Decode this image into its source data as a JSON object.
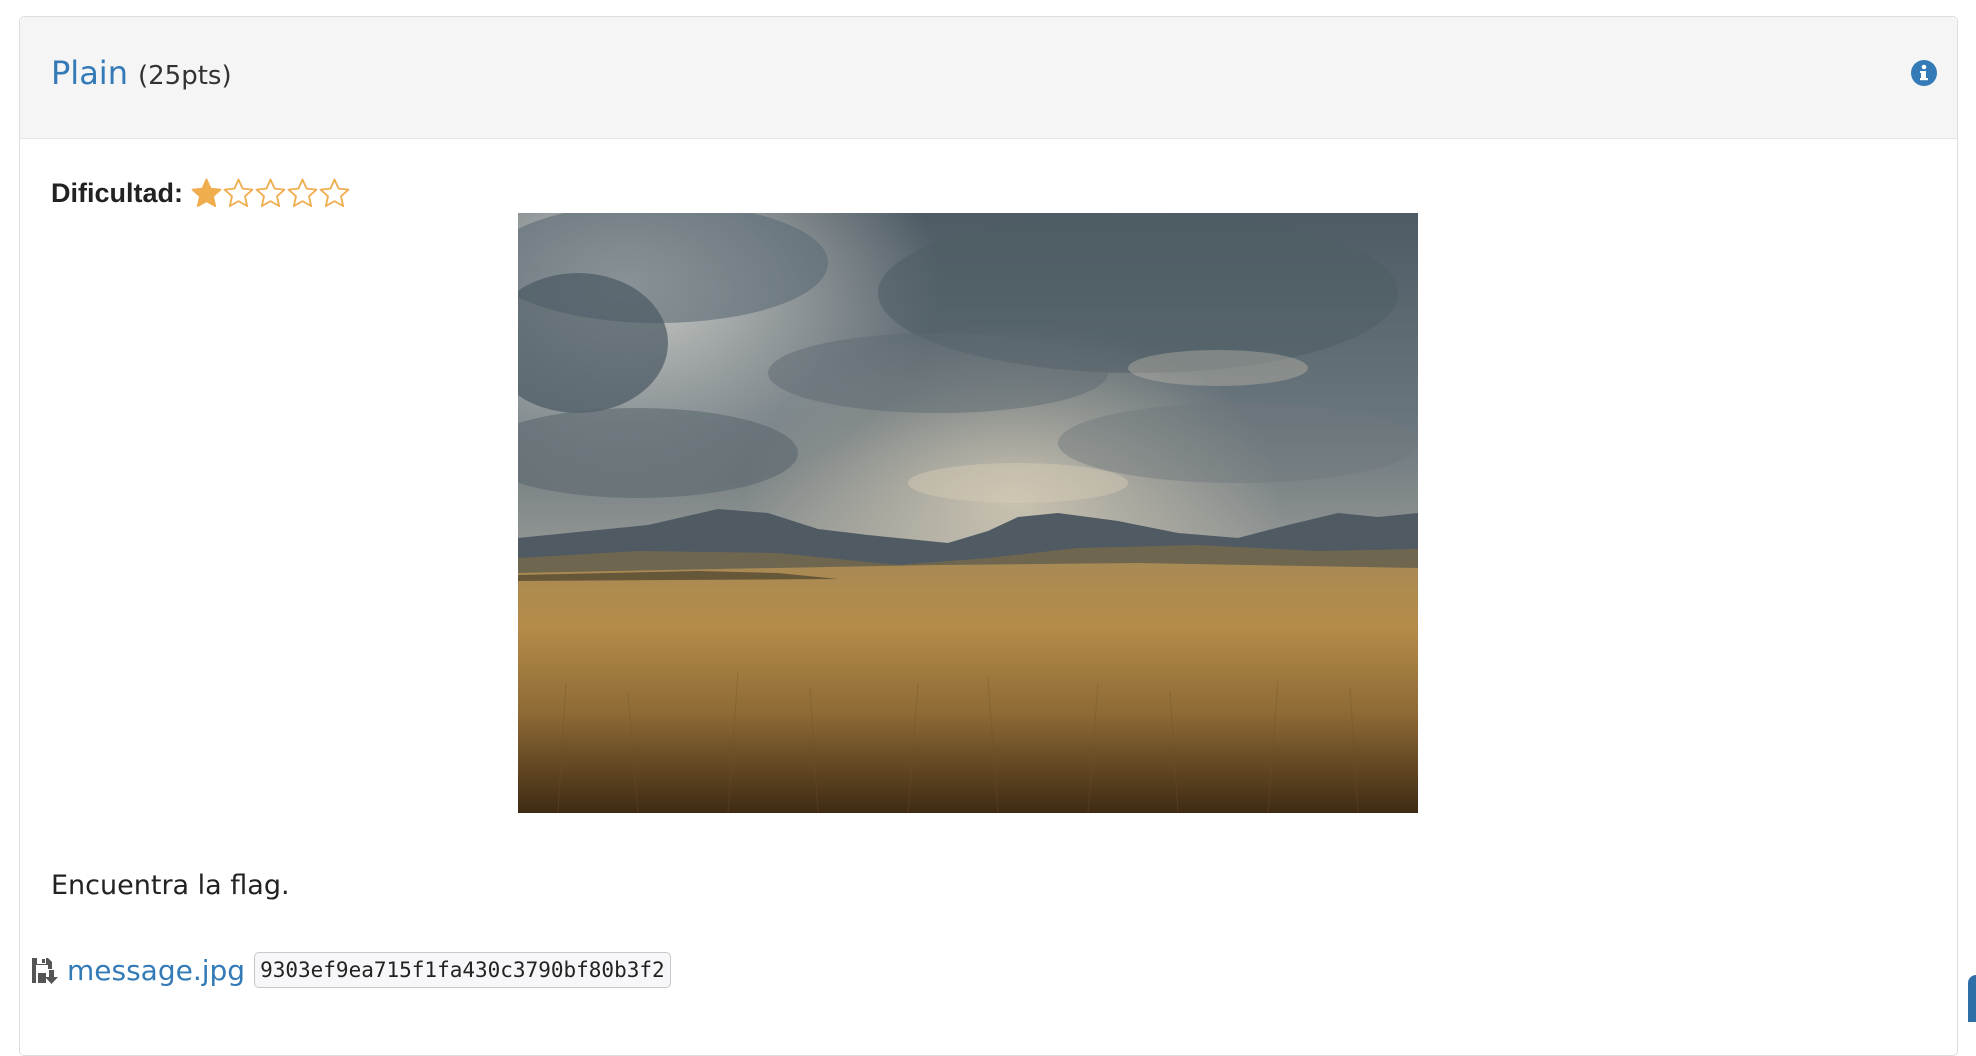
{
  "challenge": {
    "title": "Plain",
    "points": "(25pts)",
    "info_icon": "info-circle-icon"
  },
  "difficulty": {
    "label": "Dificultad:",
    "rating": 1,
    "max_rating": 5,
    "star_color": "#f0ad4e"
  },
  "image": {
    "alt": "Prairie landscape with storm clouds and mountains"
  },
  "description": "Encuentra la flag.",
  "attachment": {
    "icon": "download-file-icon",
    "filename": "message.jpg",
    "hash": "9303ef9ea715f1fa430c3790bf80b3f2"
  },
  "colors": {
    "link": "#337ab7",
    "heading_bg": "#f5f5f5"
  }
}
